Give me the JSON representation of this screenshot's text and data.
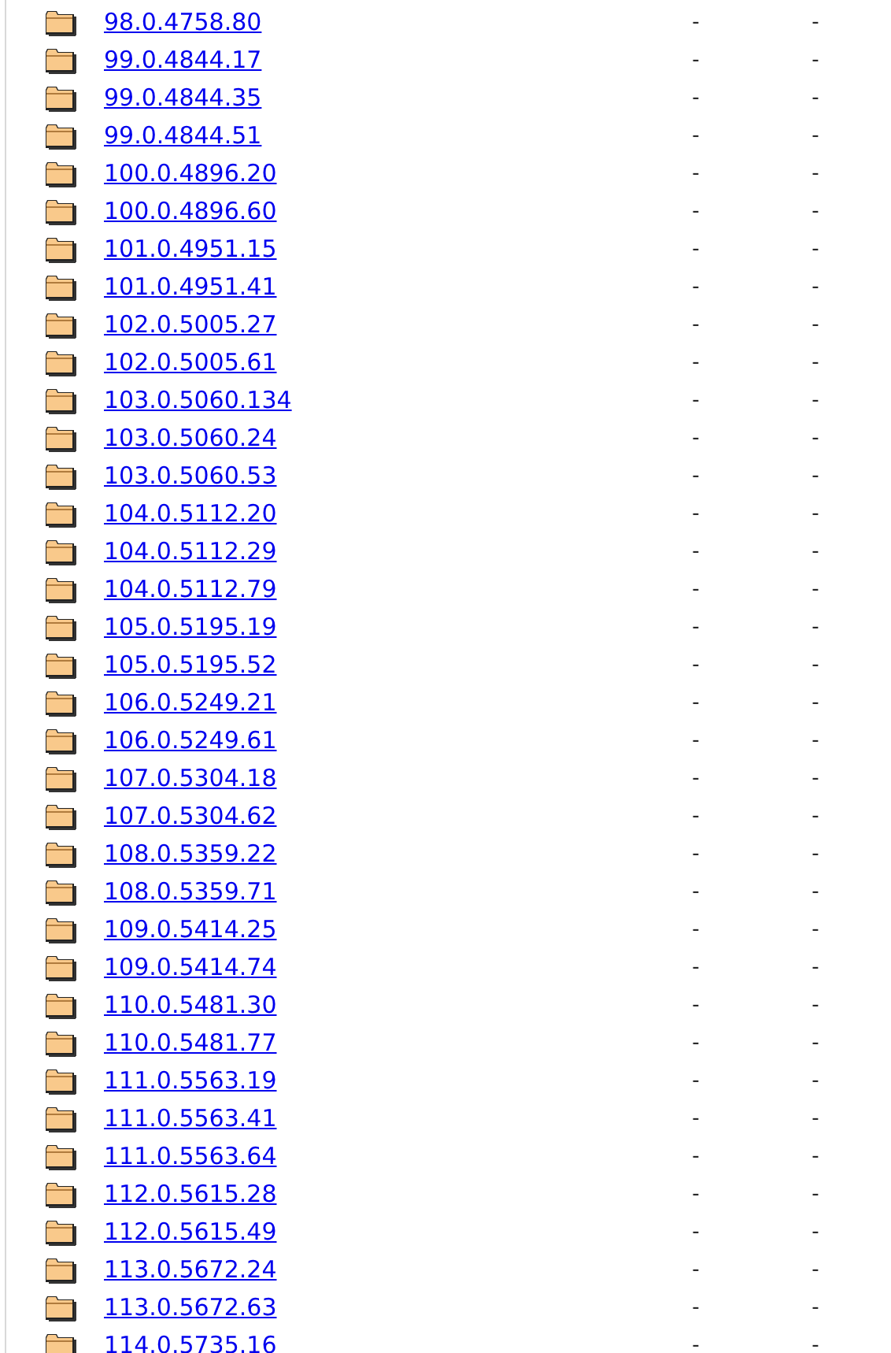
{
  "rows": [
    {
      "name": "98.0.4758.80",
      "column_2": "-",
      "column_3": "-"
    },
    {
      "name": "99.0.4844.17",
      "column_2": "-",
      "column_3": "-"
    },
    {
      "name": "99.0.4844.35",
      "column_2": "-",
      "column_3": "-"
    },
    {
      "name": "99.0.4844.51",
      "column_2": "-",
      "column_3": "-"
    },
    {
      "name": "100.0.4896.20",
      "column_2": "-",
      "column_3": "-"
    },
    {
      "name": "100.0.4896.60",
      "column_2": "-",
      "column_3": "-"
    },
    {
      "name": "101.0.4951.15",
      "column_2": "-",
      "column_3": "-"
    },
    {
      "name": "101.0.4951.41",
      "column_2": "-",
      "column_3": "-"
    },
    {
      "name": "102.0.5005.27",
      "column_2": "-",
      "column_3": "-"
    },
    {
      "name": "102.0.5005.61",
      "column_2": "-",
      "column_3": "-"
    },
    {
      "name": "103.0.5060.134",
      "column_2": "-",
      "column_3": "-"
    },
    {
      "name": "103.0.5060.24",
      "column_2": "-",
      "column_3": "-"
    },
    {
      "name": "103.0.5060.53",
      "column_2": "-",
      "column_3": "-"
    },
    {
      "name": "104.0.5112.20",
      "column_2": "-",
      "column_3": "-"
    },
    {
      "name": "104.0.5112.29",
      "column_2": "-",
      "column_3": "-"
    },
    {
      "name": "104.0.5112.79",
      "column_2": "-",
      "column_3": "-"
    },
    {
      "name": "105.0.5195.19",
      "column_2": "-",
      "column_3": "-"
    },
    {
      "name": "105.0.5195.52",
      "column_2": "-",
      "column_3": "-"
    },
    {
      "name": "106.0.5249.21",
      "column_2": "-",
      "column_3": "-"
    },
    {
      "name": "106.0.5249.61",
      "column_2": "-",
      "column_3": "-"
    },
    {
      "name": "107.0.5304.18",
      "column_2": "-",
      "column_3": "-"
    },
    {
      "name": "107.0.5304.62",
      "column_2": "-",
      "column_3": "-"
    },
    {
      "name": "108.0.5359.22",
      "column_2": "-",
      "column_3": "-"
    },
    {
      "name": "108.0.5359.71",
      "column_2": "-",
      "column_3": "-"
    },
    {
      "name": "109.0.5414.25",
      "column_2": "-",
      "column_3": "-"
    },
    {
      "name": "109.0.5414.74",
      "column_2": "-",
      "column_3": "-"
    },
    {
      "name": "110.0.5481.30",
      "column_2": "-",
      "column_3": "-"
    },
    {
      "name": "110.0.5481.77",
      "column_2": "-",
      "column_3": "-"
    },
    {
      "name": "111.0.5563.19",
      "column_2": "-",
      "column_3": "-"
    },
    {
      "name": "111.0.5563.41",
      "column_2": "-",
      "column_3": "-"
    },
    {
      "name": "111.0.5563.64",
      "column_2": "-",
      "column_3": "-"
    },
    {
      "name": "112.0.5615.28",
      "column_2": "-",
      "column_3": "-"
    },
    {
      "name": "112.0.5615.49",
      "column_2": "-",
      "column_3": "-"
    },
    {
      "name": "113.0.5672.24",
      "column_2": "-",
      "column_3": "-"
    },
    {
      "name": "113.0.5672.63",
      "column_2": "-",
      "column_3": "-"
    },
    {
      "name": "114.0.5735.16",
      "column_2": "-",
      "column_3": "-"
    }
  ]
}
